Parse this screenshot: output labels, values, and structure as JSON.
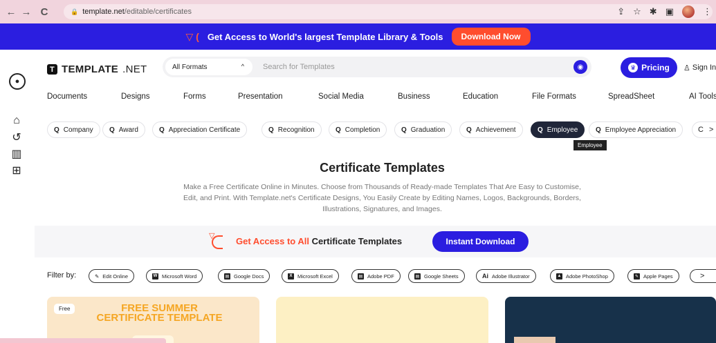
{
  "browser": {
    "url_host": "template.net",
    "url_path": "/editable/certificates"
  },
  "promo": {
    "text": "Get Access to World's largest Template Library & Tools",
    "button": "Download Now"
  },
  "header": {
    "brand_bold": "TEMPLATE",
    "brand_light": ".NET",
    "format_select": "All Formats",
    "search_placeholder": "Search for Templates",
    "pricing": "Pricing",
    "signin": "Sign In"
  },
  "categories": [
    "Documents",
    "Designs",
    "Forms",
    "Presentation",
    "Social Media",
    "Business",
    "Education",
    "File Formats",
    "SpreadSheet",
    "AI Tools"
  ],
  "chips": [
    "Company",
    "Award",
    "Appreciation Certificate",
    "Recognition",
    "Completion",
    "Graduation",
    "Achievement",
    "Employee",
    "Employee Appreciation",
    "C"
  ],
  "active_chip": "Employee",
  "tooltip": "Employee",
  "hero": {
    "title": "Certificate Templates",
    "description": "Make a Free Certificate Online in Minutes. Choose from Thousands of Ready-made Templates That Are Easy to Customise, Edit, and Print. With Template.net's Certificate Designs, You Easily Create by Editing Names, Logos, Backgrounds, Borders, Illustrations, Signatures, and Images."
  },
  "cta": {
    "prefix": "Get Access to All",
    "suffix": "Certificate Templates",
    "button": "Instant Download"
  },
  "filters": {
    "label": "Filter by:",
    "items": [
      "Edit Online",
      "Microsoft Word",
      "Google Docs",
      "Microsoft Excel",
      "Adobe PDF",
      "Google Sheets",
      "Adobe Illustrator",
      "Adobe PhotoShop",
      "Apple Pages"
    ]
  },
  "cards": {
    "card1_badge": "Free",
    "card1_title": "FREE SUMMER CERTIFICATE TEMPLATE"
  },
  "colors": {
    "brand_blue": "#2b1ee0",
    "accent_orange": "#ff4d2e",
    "chrome_pink": "#f1d4dd"
  }
}
